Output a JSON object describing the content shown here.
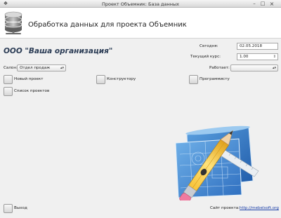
{
  "window": {
    "title": "Проект Объемник: База данных",
    "menu_glyph": "❖",
    "min_glyph": "–",
    "max_glyph": "□",
    "close_glyph": "×"
  },
  "header": {
    "icon": "database-icon",
    "title": "Обработка данных для проекта Объемник"
  },
  "org": {
    "name": "ООО \"Ваша организация\""
  },
  "fields": {
    "today_label": "Сегодня:",
    "today_value": "02.05.2018",
    "rate_label": "Текущий курс:",
    "rate_value": "1.00",
    "works_label": "Работает:",
    "works_value": "",
    "salon_label": "Салон:",
    "salon_value": "Отдел продаж",
    "arrow_glyph": "▴▾",
    "spin_glyph": "⇕"
  },
  "buttons": {
    "new_project": "Новый проект",
    "constructor": "Конструктору",
    "programmer": "Программисту",
    "project_list": "Список проектов",
    "exit": "Выход"
  },
  "footer": {
    "site_label": "Сайт проекта:",
    "site_url": "http://mebelsoft.org"
  },
  "illustration": {
    "icon": "pencil-blueprint-icon"
  }
}
